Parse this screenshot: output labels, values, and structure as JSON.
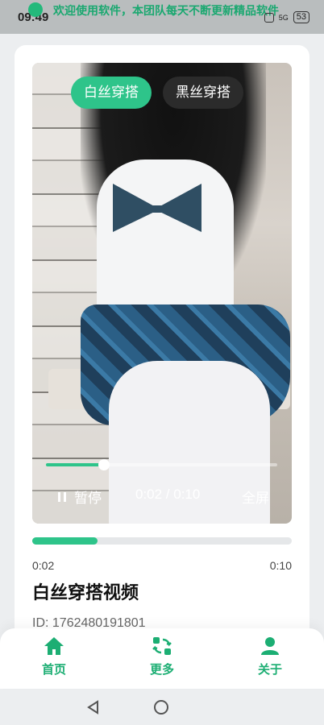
{
  "status_bar": {
    "time": "09:49",
    "banner_text": "欢迎使用软件，本团队每天不断更新精品软件",
    "battery": "53",
    "signal_label": "5G"
  },
  "video_tabs": [
    {
      "label": "白丝穿搭",
      "active": true
    },
    {
      "label": "黑丝穿搭",
      "active": false
    }
  ],
  "player": {
    "pause_label": "暂停",
    "time_readout": "0:02 / 0:10",
    "fullscreen_label": "全屏",
    "progress_fraction": 0.25
  },
  "info": {
    "current_time": "0:02",
    "total_time": "0:10",
    "title": "白丝穿搭视频",
    "id_text": "ID: 1762480191801",
    "progress_fraction": 0.25
  },
  "bottom_nav": [
    {
      "label": "首页",
      "icon": "home-icon"
    },
    {
      "label": "更多",
      "icon": "refresh-grid-icon"
    },
    {
      "label": "关于",
      "icon": "user-icon"
    }
  ],
  "colors": {
    "accent": "#2ec48a",
    "nav_text": "#1cae73",
    "tab_inactive": "#2b2b2b"
  }
}
